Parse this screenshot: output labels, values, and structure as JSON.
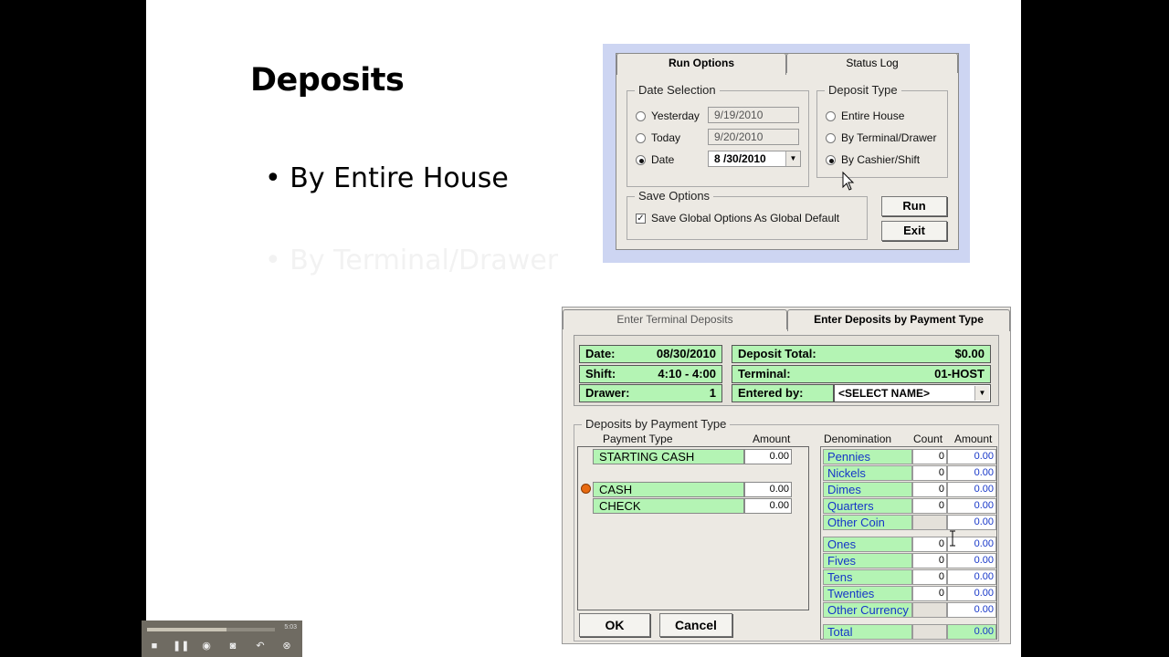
{
  "slide": {
    "title": "Deposits",
    "bullet1": "• By Entire House",
    "bullet2": "• By Terminal/Drawer"
  },
  "run_options": {
    "tabs": [
      "Run Options",
      "Status Log"
    ],
    "date_selection": {
      "legend": "Date Selection",
      "options": [
        {
          "label": "Yesterday",
          "date": "9/19/2010"
        },
        {
          "label": "Today",
          "date": "9/20/2010"
        },
        {
          "label": "Date",
          "date": "8 /30/2010"
        }
      ]
    },
    "deposit_type": {
      "legend": "Deposit Type",
      "options": [
        "Entire House",
        "By Terminal/Drawer",
        "By Cashier/Shift"
      ]
    },
    "save_options": {
      "legend": "Save Options",
      "checkbox_label": "Save Global Options As Global Default"
    },
    "run_label": "Run",
    "exit_label": "Exit"
  },
  "deposits": {
    "tabs": [
      "Enter Terminal Deposits",
      "Enter Deposits by Payment Type"
    ],
    "date_label": "Date:",
    "date_value": "08/30/2010",
    "shift_label": "Shift:",
    "shift_value": "4:10 - 4:00",
    "drawer_label": "Drawer:",
    "drawer_value": "1",
    "deposit_total_label": "Deposit Total:",
    "deposit_total_value": "$0.00",
    "terminal_label": "Terminal:",
    "terminal_value": "01-HOST",
    "entered_by_label": "Entered by:",
    "entered_by_value": "<SELECT NAME>",
    "group_legend": "Deposits by Payment Type",
    "pt_header": "Payment Type",
    "amount_header": "Amount",
    "payment_types": [
      {
        "name": "STARTING CASH",
        "amount": "0.00"
      },
      {
        "name": "CASH",
        "amount": "0.00"
      },
      {
        "name": "CHECK",
        "amount": "0.00"
      }
    ],
    "denom_header": "Denomination",
    "count_header": "Count",
    "denom_amount_header": "Amount",
    "coins": [
      {
        "name": "Pennies",
        "count": "0",
        "amount": "0.00"
      },
      {
        "name": "Nickels",
        "count": "0",
        "amount": "0.00"
      },
      {
        "name": "Dimes",
        "count": "0",
        "amount": "0.00"
      },
      {
        "name": "Quarters",
        "count": "0",
        "amount": "0.00"
      },
      {
        "name": "Other Coin",
        "count": "",
        "amount": "0.00"
      }
    ],
    "bills": [
      {
        "name": "Ones",
        "count": "0",
        "amount": "0.00"
      },
      {
        "name": "Fives",
        "count": "0",
        "amount": "0.00"
      },
      {
        "name": "Tens",
        "count": "0",
        "amount": "0.00"
      },
      {
        "name": "Twenties",
        "count": "0",
        "amount": "0.00"
      },
      {
        "name": "Other Currency",
        "count": "",
        "amount": "0.00"
      }
    ],
    "total_label": "Total",
    "total_amount": "0.00",
    "ok_label": "OK",
    "cancel_label": "Cancel"
  },
  "player": {
    "time": "5:03",
    "progress": 0.62
  }
}
